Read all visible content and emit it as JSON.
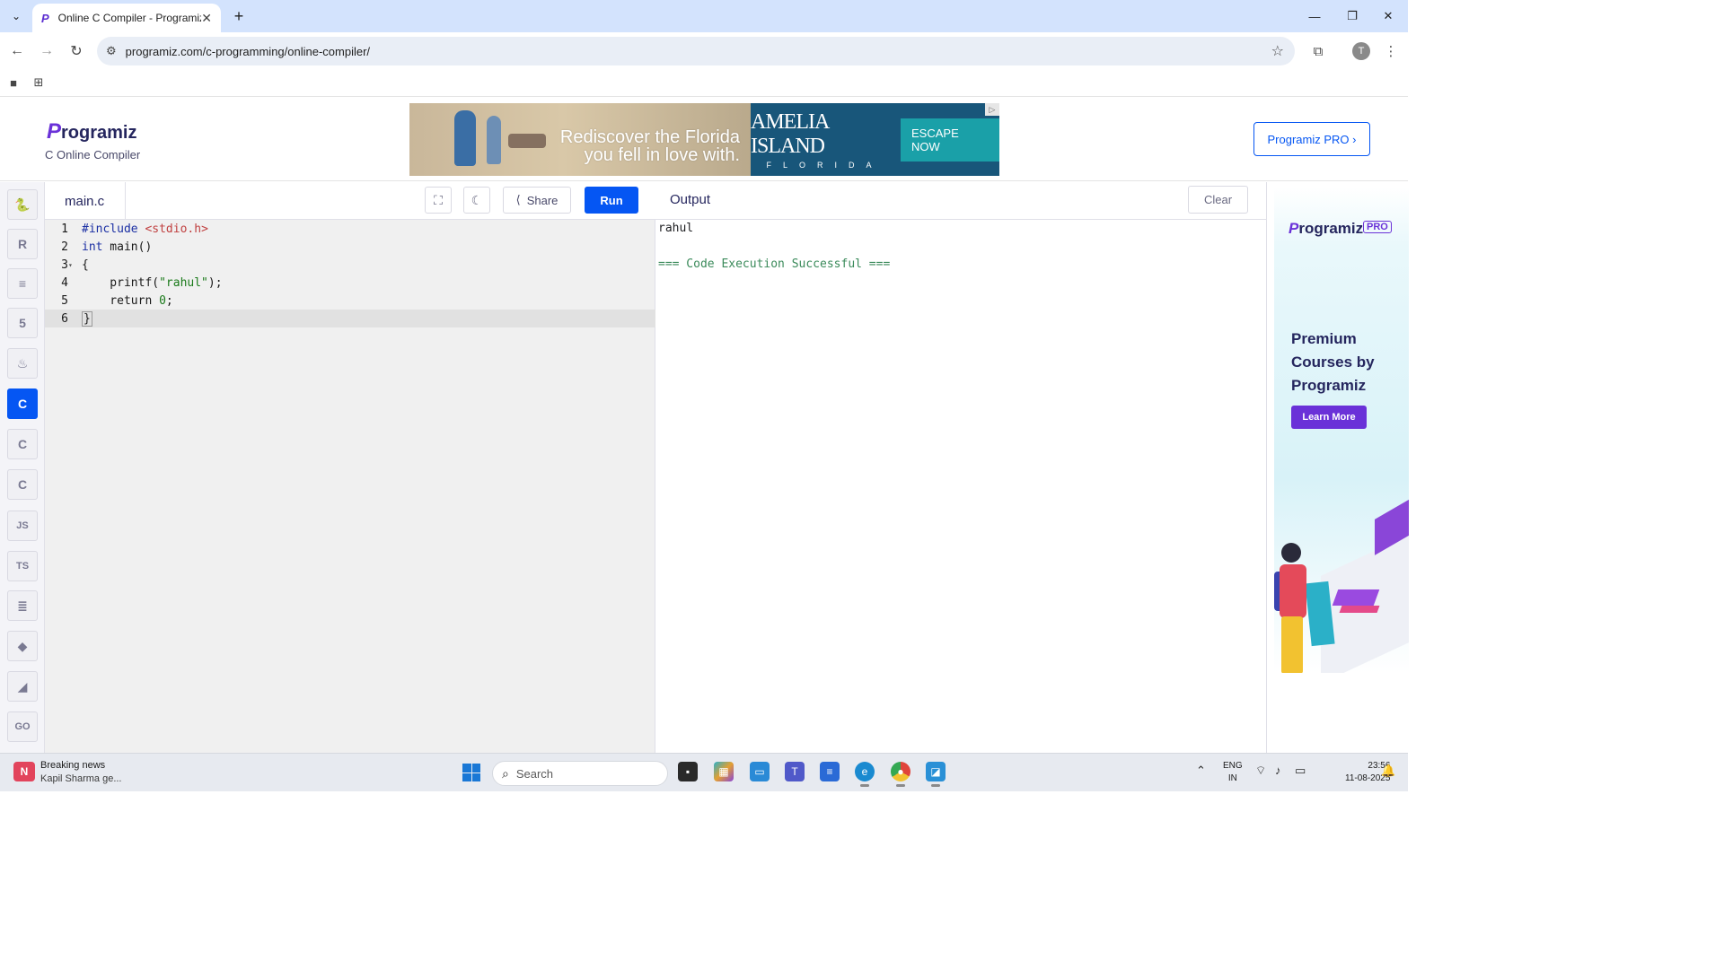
{
  "browser": {
    "tab_title": "Online C Compiler - Programiz",
    "tab_favicon": "P",
    "close_glyph": "✕",
    "new_tab_glyph": "+",
    "url": "programiz.com/c-programming/online-compiler/",
    "avatar_letter": "T"
  },
  "site": {
    "logo_first": "P",
    "logo_rest": "rogramiz",
    "subtitle": "C Online Compiler",
    "pro_button": "Programiz PRO ›",
    "ad": {
      "tagline_line1": "Rediscover the Florida",
      "tagline_line2": "you fell in love with.",
      "brand": "AMELIA ISLAND",
      "state": "FLORIDA",
      "cta": "ESCAPE NOW"
    }
  },
  "rail": {
    "items": [
      {
        "name": "python",
        "glyph": "🐍"
      },
      {
        "name": "r",
        "glyph": "R"
      },
      {
        "name": "sql",
        "glyph": "≡"
      },
      {
        "name": "html",
        "glyph": "5"
      },
      {
        "name": "java",
        "glyph": "♨"
      },
      {
        "name": "c",
        "glyph": "C"
      },
      {
        "name": "cpp",
        "glyph": "C"
      },
      {
        "name": "csharp",
        "glyph": "C"
      },
      {
        "name": "js",
        "glyph": "JS"
      },
      {
        "name": "ts",
        "glyph": "TS"
      },
      {
        "name": "swift",
        "glyph": "≣"
      },
      {
        "name": "ruby",
        "glyph": "◆"
      },
      {
        "name": "php",
        "glyph": "◢"
      },
      {
        "name": "go",
        "glyph": "GO"
      }
    ],
    "active": "c"
  },
  "editor": {
    "file_name": "main.c",
    "share_label": "Share",
    "run_label": "Run",
    "lines": [
      {
        "n": "1",
        "parts": [
          {
            "t": "#include ",
            "c": "kw"
          },
          {
            "t": "<stdio.h>",
            "c": "inc"
          }
        ]
      },
      {
        "n": "2",
        "parts": [
          {
            "t": "int",
            "c": "kw"
          },
          {
            "t": " main()",
            "c": ""
          }
        ]
      },
      {
        "n": "3",
        "parts": [
          {
            "t": "{",
            "c": ""
          }
        ],
        "fold": true
      },
      {
        "n": "4",
        "parts": [
          {
            "t": "    printf(",
            "c": ""
          },
          {
            "t": "\"rahul\"",
            "c": "str"
          },
          {
            "t": ");",
            "c": ""
          }
        ]
      },
      {
        "n": "5",
        "parts": [
          {
            "t": "    return ",
            "c": ""
          },
          {
            "t": "0",
            "c": "num"
          },
          {
            "t": ";",
            "c": ""
          }
        ]
      },
      {
        "n": "6",
        "parts": [
          {
            "t": "}",
            "c": "cursor-brace"
          }
        ],
        "current": true
      }
    ]
  },
  "output": {
    "title": "Output",
    "clear_label": "Clear",
    "program_output": "rahul",
    "status_line": "=== Code Execution Successful ==="
  },
  "right_ad": {
    "logo_first": "P",
    "logo_rest": "rogramiz",
    "badge": "PRO",
    "headline_lines": [
      "Premium",
      "Courses by",
      "Programiz"
    ],
    "button": "Learn More"
  },
  "taskbar": {
    "news_title": "Breaking news",
    "news_subtitle": "Kapil Sharma ge...",
    "search_placeholder": "Search",
    "language_line1": "ENG",
    "language_line2": "IN",
    "time": "23:56",
    "date": "11-08-2025"
  },
  "colors": {
    "accent": "#0556f3",
    "brand_purple": "#6a31d8",
    "tabstrip": "#d3e3fd"
  }
}
